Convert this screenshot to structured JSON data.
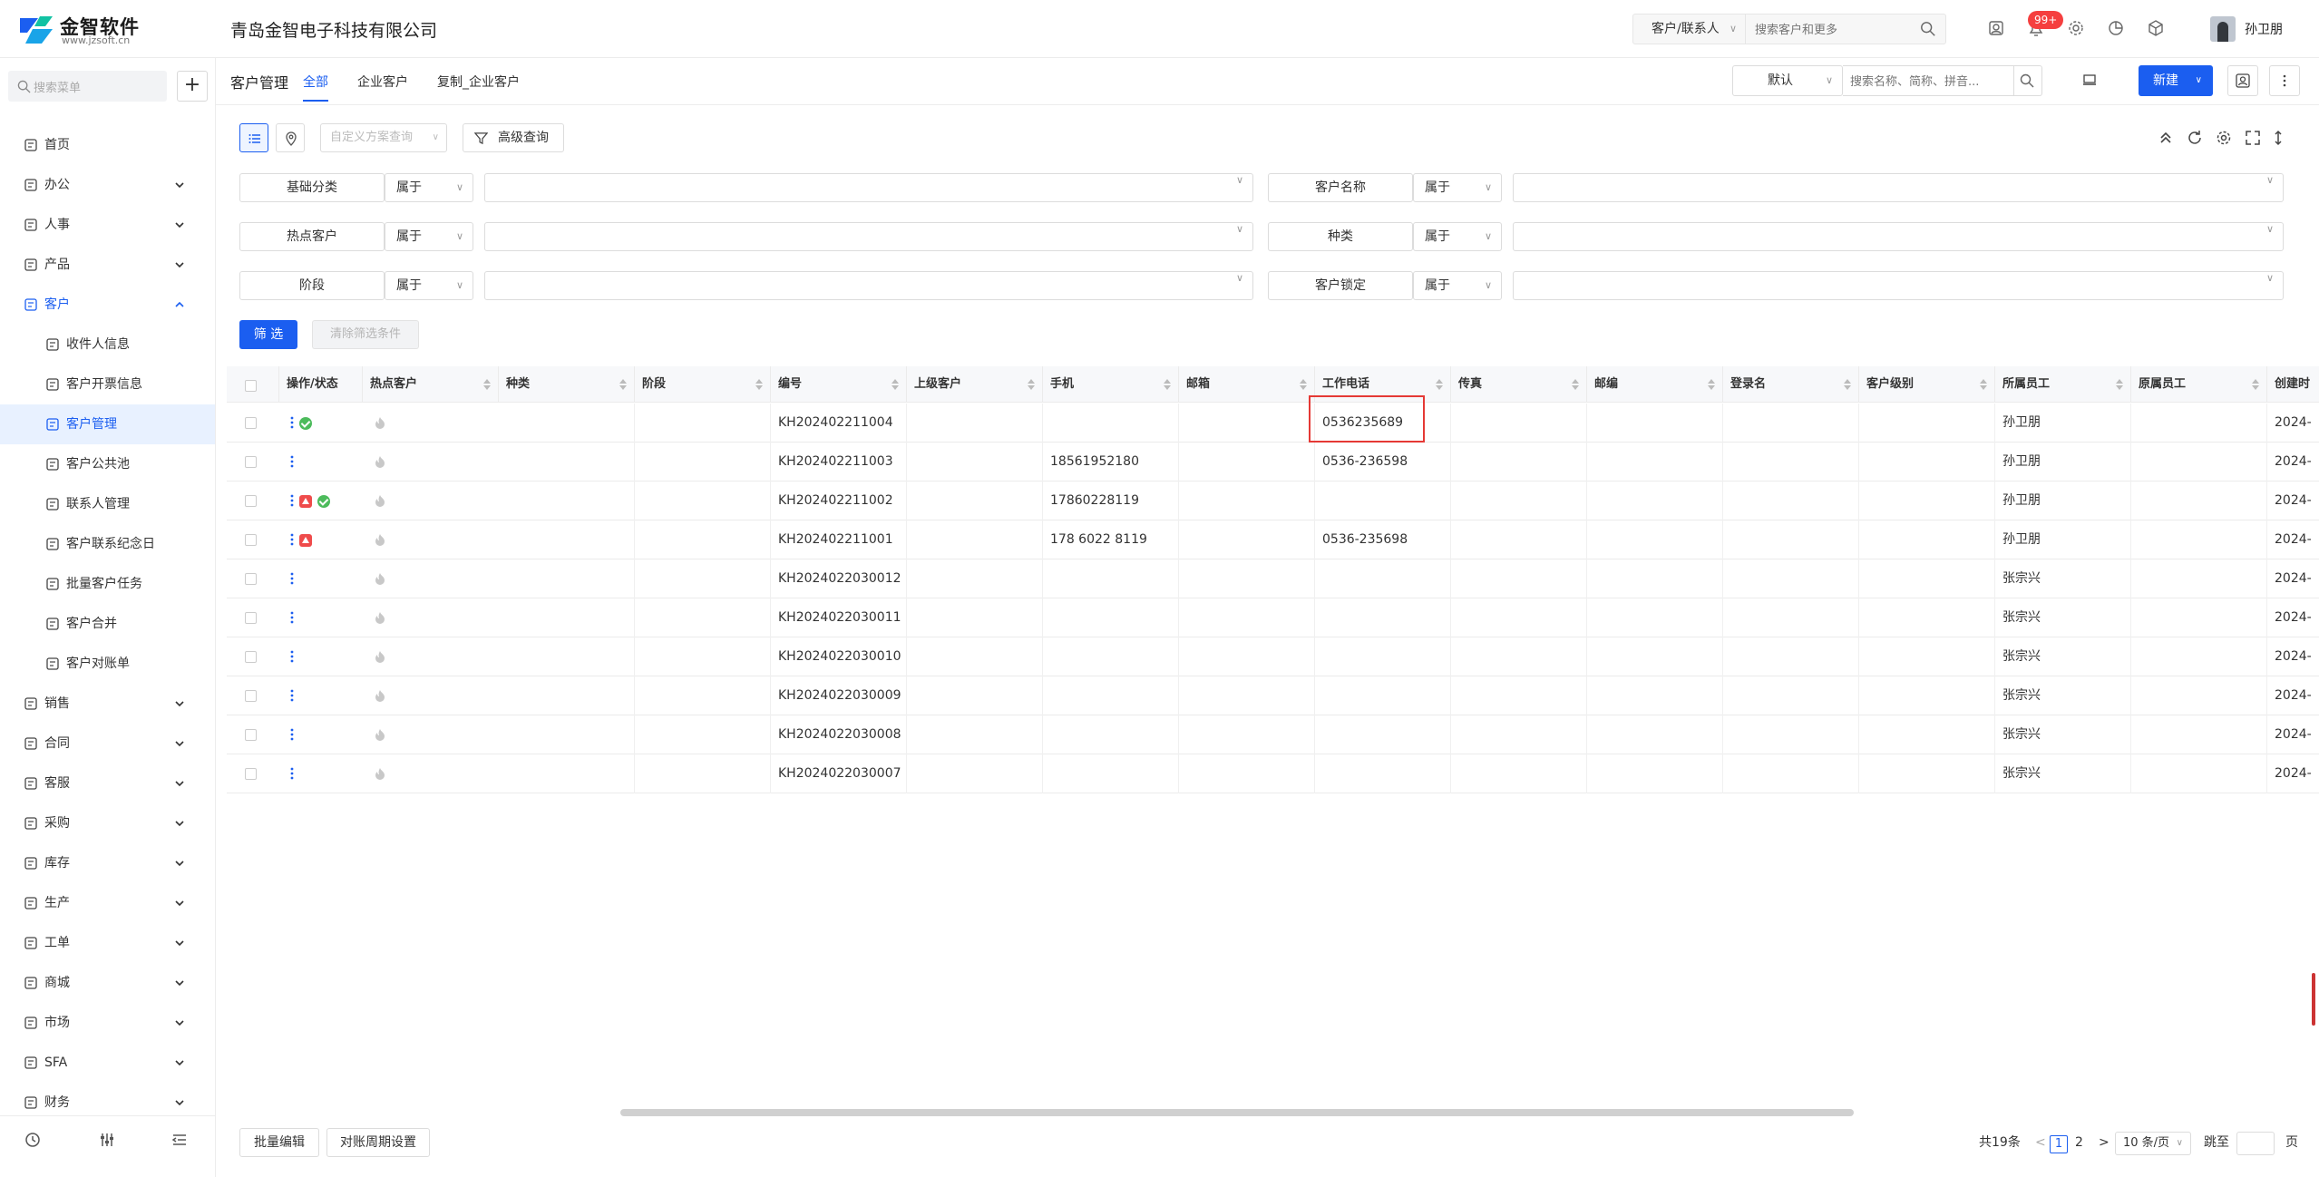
{
  "brand": {
    "name": "金智软件",
    "url": "www.jzsoft.cn"
  },
  "company": "青岛金智电子科技有限公司",
  "topbar": {
    "search_scope": "客户/联系人",
    "search_placeholder": "搜索客户和更多",
    "notification_badge": "99+",
    "user_name": "孙卫朋"
  },
  "sidebar": {
    "search_placeholder": "搜索菜单",
    "add_label": "+",
    "items": [
      {
        "label": "首页",
        "icon": "home-icon",
        "expandable": false
      },
      {
        "label": "办公",
        "icon": "office-icon",
        "expandable": true
      },
      {
        "label": "人事",
        "icon": "people-icon",
        "expandable": true
      },
      {
        "label": "产品",
        "icon": "product-icon",
        "expandable": true
      },
      {
        "label": "客户",
        "icon": "customer-icon",
        "expandable": true,
        "open": true
      }
    ],
    "sub_items": [
      {
        "label": "收件人信息",
        "icon": "recipient-icon"
      },
      {
        "label": "客户开票信息",
        "icon": "invoice-icon"
      },
      {
        "label": "客户管理",
        "icon": "customer-manage-icon",
        "active": true
      },
      {
        "label": "客户公共池",
        "icon": "pool-icon"
      },
      {
        "label": "联系人管理",
        "icon": "contact-icon"
      },
      {
        "label": "客户联系纪念日",
        "icon": "calendar-icon"
      },
      {
        "label": "批量客户任务",
        "icon": "task-icon"
      },
      {
        "label": "客户合并",
        "icon": "merge-icon"
      },
      {
        "label": "客户对账单",
        "icon": "statement-icon"
      }
    ],
    "items_after": [
      {
        "label": "销售",
        "icon": "sales-icon"
      },
      {
        "label": "合同",
        "icon": "contract-icon"
      },
      {
        "label": "客服",
        "icon": "service-icon"
      },
      {
        "label": "采购",
        "icon": "purchase-icon"
      },
      {
        "label": "库存",
        "icon": "inventory-icon"
      },
      {
        "label": "生产",
        "icon": "production-icon"
      },
      {
        "label": "工单",
        "icon": "workorder-icon"
      },
      {
        "label": "商城",
        "icon": "mall-icon"
      },
      {
        "label": "市场",
        "icon": "market-icon"
      },
      {
        "label": "SFA",
        "icon": "sfa-icon"
      },
      {
        "label": "财务",
        "icon": "finance-icon"
      }
    ]
  },
  "page": {
    "title": "客户管理",
    "tabs": [
      {
        "label": "全部",
        "active": true
      },
      {
        "label": "企业客户",
        "active": false
      },
      {
        "label": "复制_企业客户",
        "active": false
      }
    ],
    "view_select": "默认",
    "search_placeholder": "搜索名称、简称、拼音...",
    "new_button": "新建"
  },
  "toolbar": {
    "scheme_placeholder": "自定义方案查询",
    "advanced_query": "高级查询"
  },
  "filters": [
    {
      "label": "基础分类",
      "op": "属于"
    },
    {
      "label": "客户名称",
      "op": "属于"
    },
    {
      "label": "热点客户",
      "op": "属于"
    },
    {
      "label": "种类",
      "op": "属于"
    },
    {
      "label": "阶段",
      "op": "属于"
    },
    {
      "label": "客户锁定",
      "op": "属于"
    }
  ],
  "filter_actions": {
    "apply": "筛 选",
    "clear": "清除筛选条件"
  },
  "table": {
    "columns": [
      "操作/状态",
      "热点客户",
      "种类",
      "阶段",
      "编号",
      "上级客户",
      "手机",
      "邮箱",
      "工作电话",
      "传真",
      "邮编",
      "登录名",
      "客户级别",
      "所属员工",
      "原属员工",
      "创建时"
    ],
    "rows": [
      {
        "status": [
          "ok"
        ],
        "code": "KH202402211004",
        "mobile": "",
        "work_phone": "0536235689",
        "staff": "孙卫朋",
        "created": "2024-"
      },
      {
        "status": [],
        "code": "KH202402211003",
        "mobile": "18561952180",
        "work_phone": "0536-236598",
        "staff": "孙卫朋",
        "created": "2024-"
      },
      {
        "status": [
          "warn",
          "ok"
        ],
        "code": "KH202402211002",
        "mobile": "17860228119",
        "work_phone": "",
        "staff": "孙卫朋",
        "created": "2024-"
      },
      {
        "status": [
          "warn"
        ],
        "code": "KH202402211001",
        "mobile": "178 6022 8119",
        "work_phone": "0536-235698",
        "staff": "孙卫朋",
        "created": "2024-"
      },
      {
        "status": [],
        "code": "KH2024022030012",
        "mobile": "",
        "work_phone": "",
        "staff": "张宗兴",
        "created": "2024-"
      },
      {
        "status": [],
        "code": "KH2024022030011",
        "mobile": "",
        "work_phone": "",
        "staff": "张宗兴",
        "created": "2024-"
      },
      {
        "status": [],
        "code": "KH2024022030010",
        "mobile": "",
        "work_phone": "",
        "staff": "张宗兴",
        "created": "2024-"
      },
      {
        "status": [],
        "code": "KH2024022030009",
        "mobile": "",
        "work_phone": "",
        "staff": "张宗兴",
        "created": "2024-"
      },
      {
        "status": [],
        "code": "KH2024022030008",
        "mobile": "",
        "work_phone": "",
        "staff": "张宗兴",
        "created": "2024-"
      },
      {
        "status": [],
        "code": "KH2024022030007",
        "mobile": "",
        "work_phone": "",
        "staff": "张宗兴",
        "created": "2024-"
      }
    ]
  },
  "footer": {
    "batch_edit": "批量编辑",
    "period_settings": "对账周期设置",
    "total": "共19条",
    "prev": "<",
    "pages": [
      "1",
      "2"
    ],
    "next": ">",
    "page_size": "10 条/页",
    "jump_label": "跳至",
    "page_unit": "页"
  },
  "colors": {
    "primary": "#1b5ef0",
    "highlight": "#e53935",
    "ok": "#4cbb5b",
    "warn": "#ef4b4b"
  }
}
